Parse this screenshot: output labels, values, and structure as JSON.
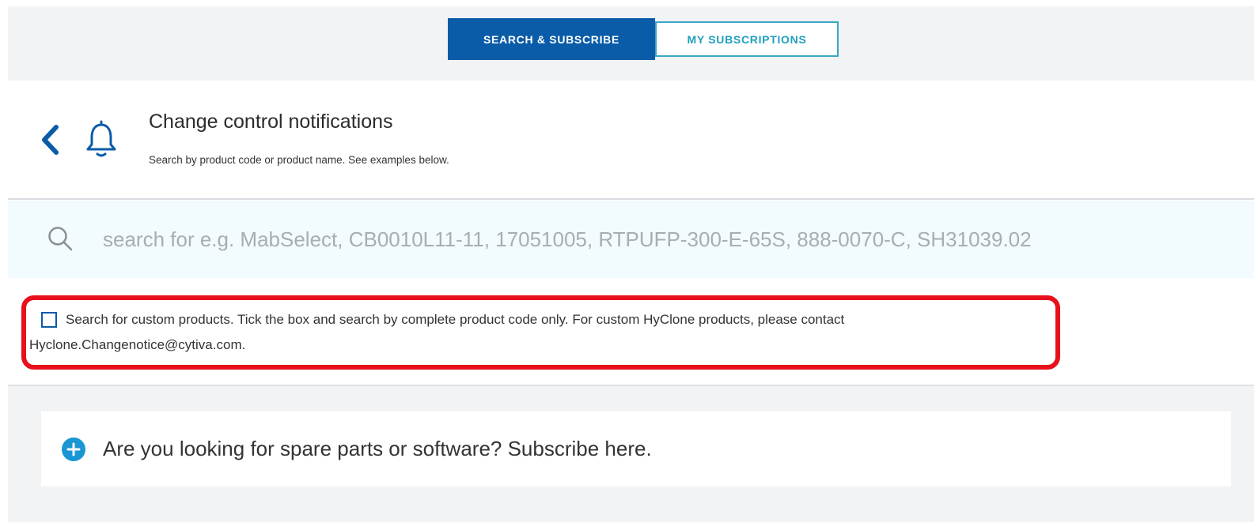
{
  "tabs": [
    {
      "label": "SEARCH & SUBSCRIBE",
      "active": true
    },
    {
      "label": "MY SUBSCRIPTIONS",
      "active": false
    }
  ],
  "header": {
    "title": "Change control notifications",
    "subtitle": "Search by product code or product name. See examples below.",
    "icons": [
      "chevron-left-icon",
      "bell-icon"
    ]
  },
  "search": {
    "placeholder": "search for e.g. MabSelect, CB0010L11-11, 17051005, RTPUFP-300-E-65S, 888-0070-C, SH31039.02",
    "value": "",
    "icon": "search-icon"
  },
  "custom_products": {
    "checked": false,
    "line1": "Search for custom products. Tick the box and search by complete product code only. For custom HyClone products, please contact",
    "line2": "Hyclone.Changenotice@cytiva.com."
  },
  "spare_parts": {
    "text": "Are you looking for spare parts or software? Subscribe here.",
    "icon": "plus-circle-icon"
  },
  "colors": {
    "primary_blue": "#0a5ca8",
    "teal": "#1fa0bf",
    "highlight_red": "#e8101c",
    "search_bg": "#f2fbfd"
  }
}
